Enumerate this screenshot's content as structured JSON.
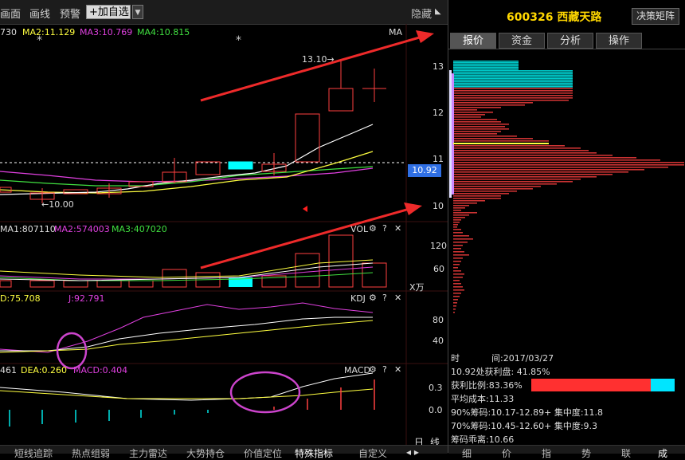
{
  "toolbar": {
    "draw_label": "画线",
    "alert_label": "预警",
    "add_watch_label": "+加自选",
    "hide_label": "隐藏",
    "page_label": "画面"
  },
  "kline": {
    "ma1": "730",
    "ma2": "MA2:11.129",
    "ma3": "MA3:10.769",
    "ma4": "MA4:10.815",
    "ma_tag": "MA",
    "high_note": "13.10→",
    "low_note": "←10.00",
    "current_price": "10.92",
    "axis": [
      "13",
      "12",
      "11",
      "10"
    ]
  },
  "volume": {
    "ma1": "MA1:807110",
    "ma2": "MA2:574003",
    "ma3": "MA3:407020",
    "tag": "VOL",
    "axis": [
      "120",
      "60"
    ],
    "unit": "X万"
  },
  "kdj": {
    "d": "D:75.708",
    "j": "J:92.791",
    "tag": "KDJ",
    "axis": [
      "80",
      "40"
    ]
  },
  "macd": {
    "dif": "461",
    "dea": "DEA:0.260",
    "macd": "MACD:0.404",
    "tag": "MACD",
    "axis": [
      "0.3",
      "0.0"
    ]
  },
  "period": {
    "day": "日",
    "line": "线"
  },
  "stock": {
    "code_name": "600326 西藏天路",
    "decision_label": "决策矩阵"
  },
  "tabs": [
    {
      "label": "报价"
    },
    {
      "label": "资金"
    },
    {
      "label": "分析"
    },
    {
      "label": "操作"
    }
  ],
  "chip": {
    "axis": [
      "13",
      "12",
      "11",
      "10"
    ]
  },
  "info": {
    "time_label": "时",
    "time_value": "间:2017/03/27",
    "profit_line": "10.92处获利盘: 41.85%",
    "profit_ratio": "获利比例:83.36%",
    "avg_cost": "平均成本:11.33",
    "c90": "90%筹码:10.17-12.89+ 集中度:11.8",
    "c70": "70%筹码:10.45-12.60+ 集中度:9.3",
    "chip_mult": "筹码乖离:10.66"
  },
  "bottom_tabs": [
    {
      "label": "短线追踪"
    },
    {
      "label": "热点组弱"
    },
    {
      "label": "主力雷达"
    },
    {
      "label": "大势持仓"
    },
    {
      "label": "价值定位"
    },
    {
      "label": "特殊指标"
    },
    {
      "label": "自定义"
    }
  ],
  "bottom_right_tabs": [
    {
      "label": "细"
    },
    {
      "label": "价"
    },
    {
      "label": "指"
    },
    {
      "label": "势"
    },
    {
      "label": "联"
    },
    {
      "label": "成"
    }
  ],
  "colors": {
    "up": "#ff4040",
    "down": "#00ffff",
    "ma_white": "#ffffff",
    "ma_yellow": "#ffff40",
    "ma_magenta": "#e040e0",
    "ma_green": "#40e040",
    "profit_bar": "#ff3030",
    "loss_bar": "#00e5ff",
    "arrow": "#ee2a2a",
    "highlight_circle": "#cc44cc"
  },
  "profit_ratio_value": 0.8336
}
